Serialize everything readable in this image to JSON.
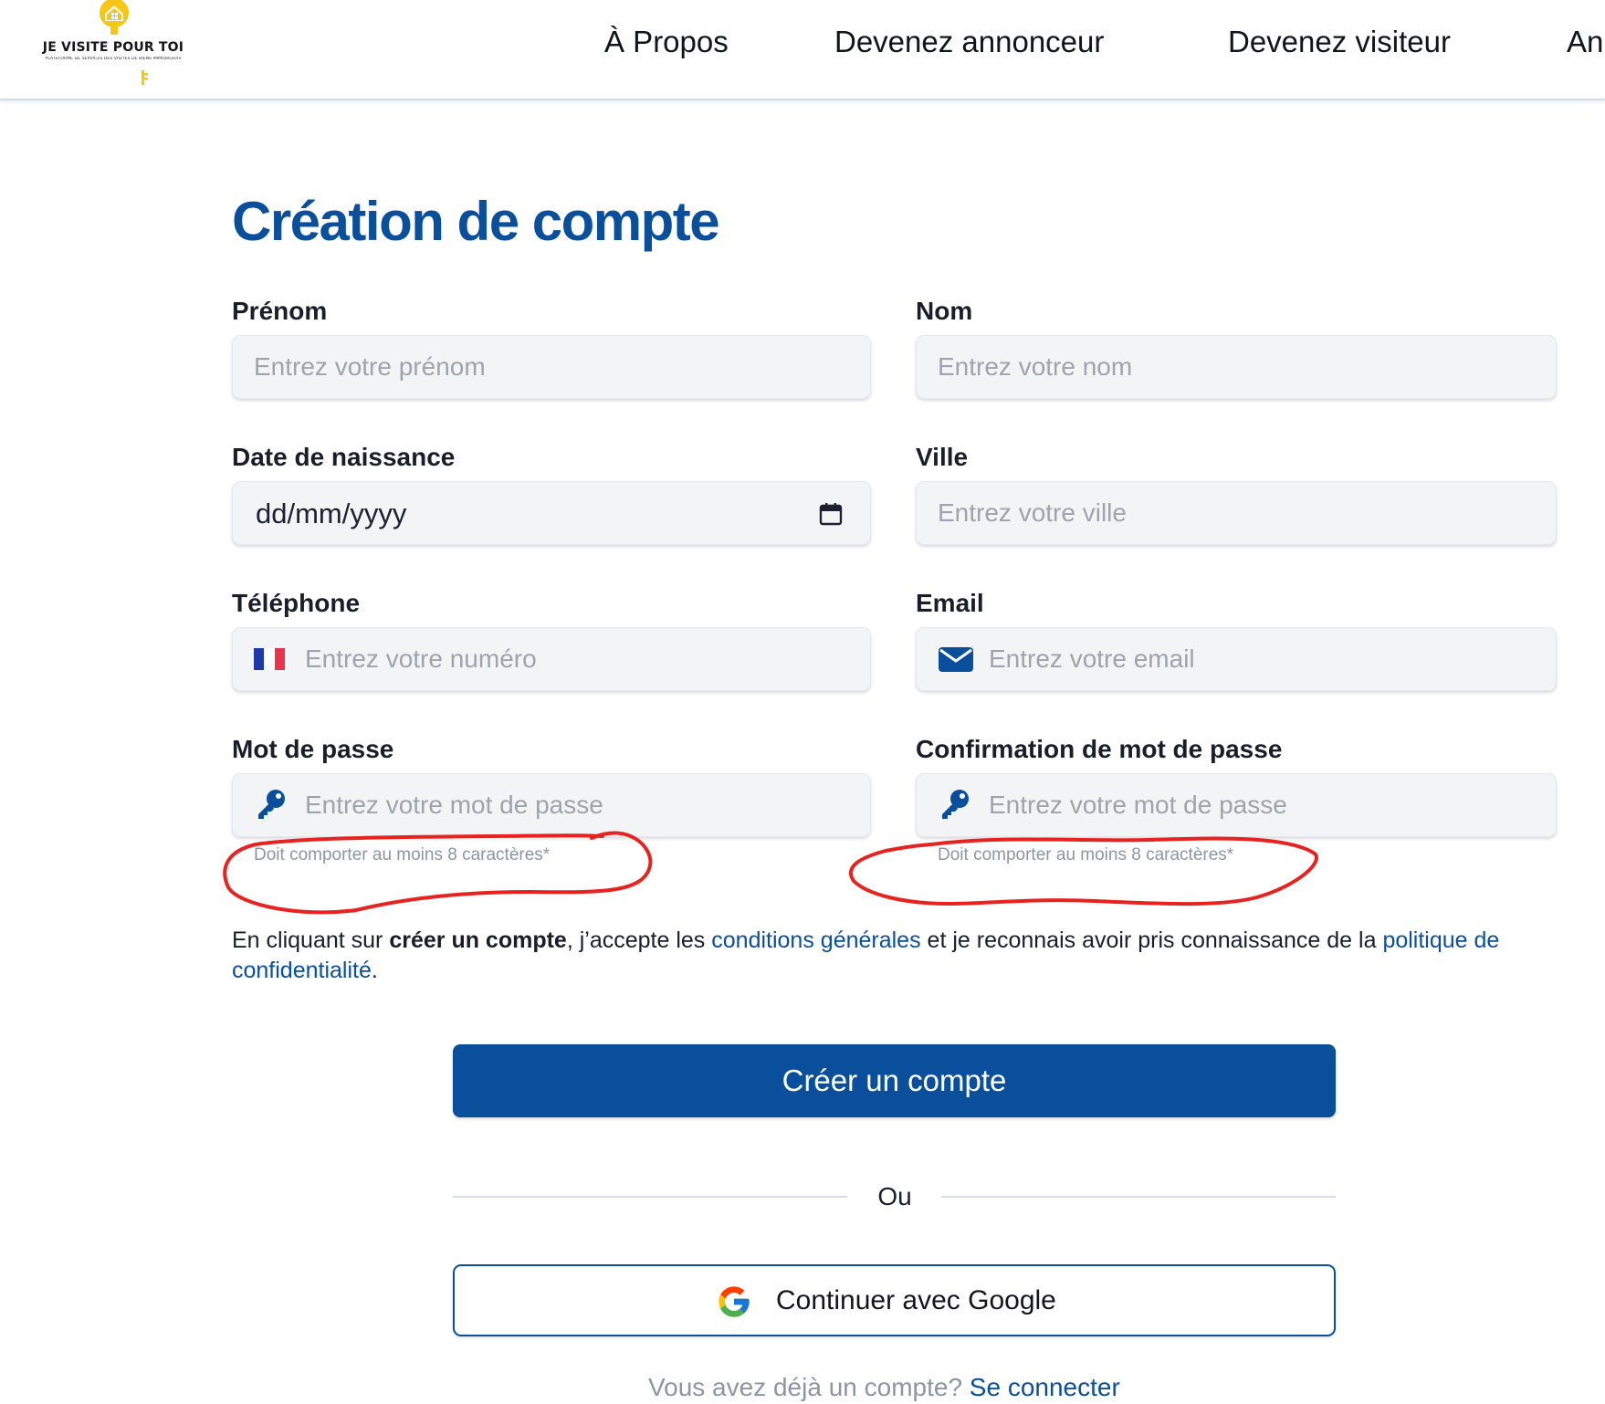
{
  "header": {
    "logo": {
      "title": "JE VISITE POUR TOI",
      "tagline": "PLATEFORME DE SERVICES DES VISITES DE BIENS IMMOBILIERS",
      "icon": "house-key-logo-icon"
    },
    "nav": [
      {
        "label": "À Propos"
      },
      {
        "label": "Devenez annonceur"
      },
      {
        "label": "Devenez visiteur"
      },
      {
        "label": "An"
      }
    ]
  },
  "form": {
    "title": "Création de compte",
    "fields": {
      "first_name": {
        "label": "Prénom",
        "placeholder": "Entrez votre prénom",
        "value": ""
      },
      "last_name": {
        "label": "Nom",
        "placeholder": "Entrez votre nom",
        "value": ""
      },
      "birth_date": {
        "label": "Date de naissance",
        "display_value": "dd/mm/yyyy",
        "icon": "calendar-icon"
      },
      "city": {
        "label": "Ville",
        "placeholder": "Entrez votre ville",
        "value": ""
      },
      "phone": {
        "label": "Téléphone",
        "placeholder": "Entrez votre numéro",
        "icon": "france-flag-icon",
        "value": ""
      },
      "email": {
        "label": "Email",
        "placeholder": "Entrez votre email",
        "icon": "envelope-icon",
        "value": ""
      },
      "password": {
        "label": "Mot de passe",
        "placeholder": "Entrez votre mot de passe",
        "hint": "Doit comporter au moins 8 caractères*",
        "icon": "key-icon"
      },
      "password_confirm": {
        "label": "Confirmation de mot de passe",
        "placeholder": "Entrez votre mot de passe",
        "hint": "Doit comporter au moins 8 caractères*",
        "icon": "key-icon"
      }
    },
    "consent": {
      "prefix": "En cliquant sur ",
      "bold": "créer un compte",
      "middle": ", j’accepte les ",
      "terms_link": "conditions générales",
      "middle2": " et je reconnais avoir pris connaissance de la ",
      "privacy_link": "politique de confidentialité",
      "suffix": "."
    },
    "submit_label": "Créer un compte",
    "divider_label": "Ou",
    "google_label": "Continuer avec Google",
    "signin": {
      "prefix": "Vous avez déjà un compte? ",
      "link": "Se connecter"
    }
  },
  "colors": {
    "brand_blue": "#0a4f9c",
    "logo_yellow": "#f5c518",
    "input_bg": "#f3f4f6",
    "annotation_red": "#e8231f"
  }
}
